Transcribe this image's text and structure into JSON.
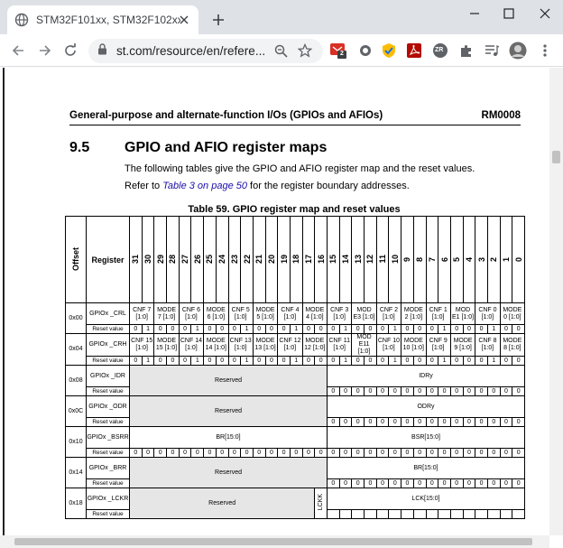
{
  "browser": {
    "tab_title": "STM32F101xx, STM32F102xx, STM",
    "url": "st.com/resource/en/refere...",
    "extension_badge": "2",
    "extension_zr": "ZR"
  },
  "doc": {
    "header_left": "General-purpose and alternate-function I/Os (GPIOs and AFIOs)",
    "header_right": "RM0008",
    "section_number": "9.5",
    "section_title": "GPIO and AFIO register maps",
    "para1": "The following tables give the GPIO and AFIO register map and the reset values.",
    "para2_prefix": "Refer to ",
    "para2_link": "Table 3 on page 50",
    "para2_suffix": " for the register boundary addresses.",
    "table_caption": "Table 59. GPIO register map and reset values"
  },
  "table": {
    "col_offset": "Offset",
    "col_register": "Register",
    "bits": [
      "31",
      "30",
      "29",
      "28",
      "27",
      "26",
      "25",
      "24",
      "23",
      "22",
      "21",
      "20",
      "19",
      "18",
      "17",
      "16",
      "15",
      "14",
      "13",
      "12",
      "11",
      "10",
      "9",
      "8",
      "7",
      "6",
      "5",
      "4",
      "3",
      "2",
      "1",
      "0"
    ],
    "reset_label": "Reset value",
    "crl": {
      "offset": "0x00",
      "name": "GPIOx _CRL",
      "fields": [
        "CNF 7 [1:0]",
        "MODE 7 [1:0]",
        "CNF 6 [1:0]",
        "MODE 6 [1:0]",
        "CNF 5 [1:0]",
        "MODE 5 [1:0]",
        "CNF 4 [1:0]",
        "MODE 4 [1:0]",
        "CNF 3 [1:0]",
        "MOD E3 [1:0]",
        "CNF 2 [1:0]",
        "MODE 2 [1:0]",
        "CNF 1 [1:0]",
        "MOD E1 [1:0]",
        "CNF 0 [1:0]",
        "MODE 0 [1:0]"
      ],
      "reset": [
        "0",
        "1",
        "0",
        "0",
        "0",
        "1",
        "0",
        "0",
        "0",
        "1",
        "0",
        "0",
        "0",
        "1",
        "0",
        "0",
        "0",
        "1",
        "0",
        "0",
        "0",
        "1",
        "0",
        "0",
        "0",
        "1",
        "0",
        "0",
        "0",
        "1",
        "0",
        "0"
      ]
    },
    "crh": {
      "offset": "0x04",
      "name": "GPIOx _CRH",
      "fields": [
        "CNF 15 [1:0]",
        "MODE 15 [1:0]",
        "CNF 14 [1:0]",
        "MODE 14 [1:0]",
        "CNF 13 [1:0]",
        "MODE 13 [1:0]",
        "CNF 12 [1:0]",
        "MODE 12 [1:0]",
        "CNF 11 [1:0]",
        "MOD E11 [1:0]",
        "CNF 10 [1:0]",
        "MODE 10 [1:0]",
        "CNF 9 [1:0]",
        "MODE 9 [1:0]",
        "CNF 8 [1:0]",
        "MODE 8 [1:0]"
      ],
      "reset": [
        "0",
        "1",
        "0",
        "0",
        "0",
        "1",
        "0",
        "0",
        "0",
        "1",
        "0",
        "0",
        "0",
        "1",
        "0",
        "0",
        "0",
        "1",
        "0",
        "0",
        "0",
        "1",
        "0",
        "0",
        "0",
        "1",
        "0",
        "0",
        "0",
        "1",
        "0",
        "0"
      ]
    },
    "idr": {
      "offset": "0x08",
      "name": "GPIOx _IDR",
      "reserved": "Reserved",
      "field": "IDRy",
      "reset": [
        "0",
        "0",
        "0",
        "0",
        "0",
        "0",
        "0",
        "0",
        "0",
        "0",
        "0",
        "0",
        "0",
        "0",
        "0",
        "0"
      ]
    },
    "odr": {
      "offset": "0x0C",
      "name": "GPIOx _ODR",
      "reserved": "Reserved",
      "field": "ODRy",
      "reset": [
        "0",
        "0",
        "0",
        "0",
        "0",
        "0",
        "0",
        "0",
        "0",
        "0",
        "0",
        "0",
        "0",
        "0",
        "0",
        "0"
      ]
    },
    "bsrr": {
      "offset": "0x10",
      "name": "GPIOx _BSRR",
      "field_hi": "BR[15:0]",
      "field_lo": "BSR[15:0]",
      "reset": [
        "0",
        "0",
        "0",
        "0",
        "0",
        "0",
        "0",
        "0",
        "0",
        "0",
        "0",
        "0",
        "0",
        "0",
        "0",
        "0",
        "0",
        "0",
        "0",
        "0",
        "0",
        "0",
        "0",
        "0",
        "0",
        "0",
        "0",
        "0",
        "0",
        "0",
        "0",
        "0"
      ]
    },
    "brr": {
      "offset": "0x14",
      "name": "GPIOx _BRR",
      "reserved": "Reserved",
      "field": "BR[15:0]",
      "reset": [
        "0",
        "0",
        "0",
        "0",
        "0",
        "0",
        "0",
        "0",
        "0",
        "0",
        "0",
        "0",
        "0",
        "0",
        "0",
        "0"
      ]
    },
    "lckr": {
      "offset": "0x18",
      "name": "GPIOx _LCKR",
      "reserved": "Reserved",
      "lckk": "LCKK",
      "field": "LCK[15:0]"
    }
  }
}
